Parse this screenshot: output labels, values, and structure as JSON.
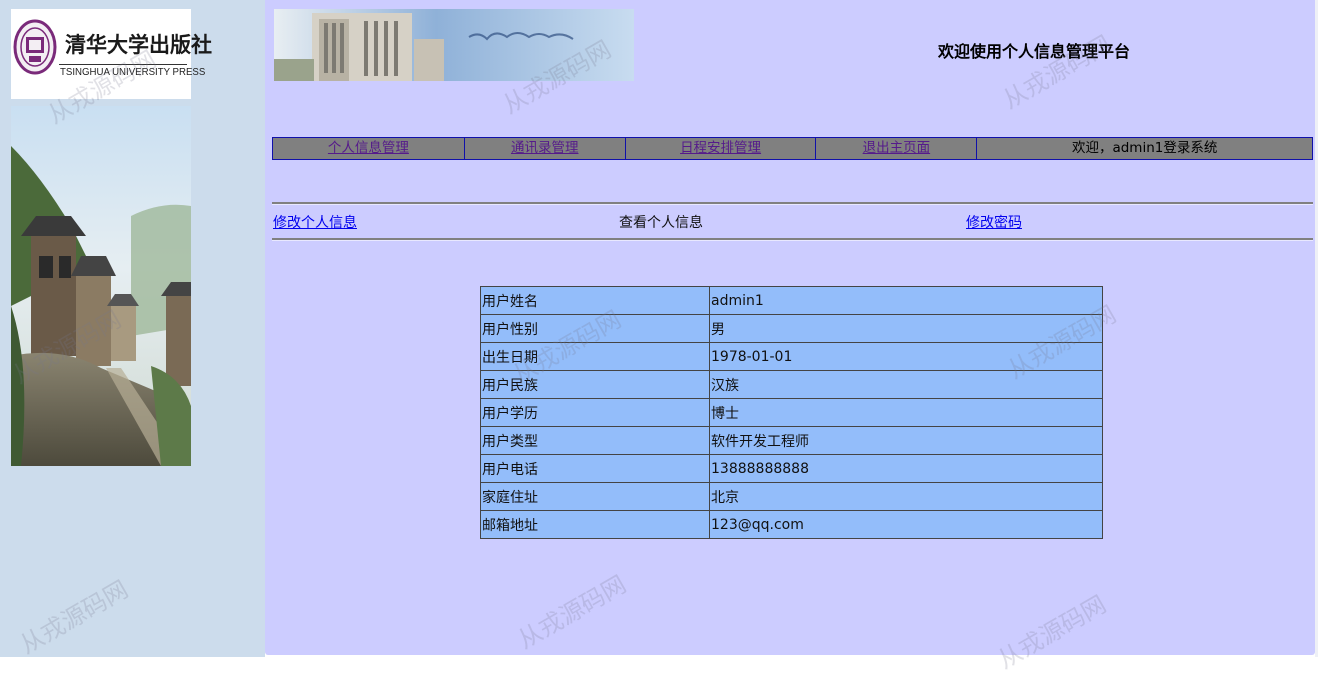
{
  "publisher": {
    "name_cn": "清华大学出版社",
    "name_en": "TSINGHUA UNIVERSITY PRESS"
  },
  "header": {
    "title": "欢迎使用个人信息管理平台"
  },
  "nav": {
    "items": [
      {
        "label": "个人信息管理"
      },
      {
        "label": "通讯录管理"
      },
      {
        "label": "日程安排管理"
      },
      {
        "label": "退出主页面"
      }
    ],
    "welcome": "欢迎，admin1登录系统"
  },
  "submenu": {
    "edit_info": "修改个人信息",
    "view_info": "查看个人信息",
    "change_password": "修改密码"
  },
  "user_info": {
    "rows": [
      {
        "label": "用户姓名",
        "value": "admin1"
      },
      {
        "label": "用户性别",
        "value": "男"
      },
      {
        "label": "出生日期",
        "value": "1978-01-01"
      },
      {
        "label": "用户民族",
        "value": "汉族"
      },
      {
        "label": "用户学历",
        "value": "博士"
      },
      {
        "label": "用户类型",
        "value": "软件开发工程师"
      },
      {
        "label": "用户电话",
        "value": "13888888888"
      },
      {
        "label": "家庭住址",
        "value": "北京"
      },
      {
        "label": "邮箱地址",
        "value": "123@qq.com"
      }
    ]
  },
  "watermark": "从戎源码网",
  "colors": {
    "sidebar_bg": "#ccdcec",
    "main_bg": "#ccccff",
    "nav_bg": "#808080",
    "table_bg": "#93bdfa"
  }
}
